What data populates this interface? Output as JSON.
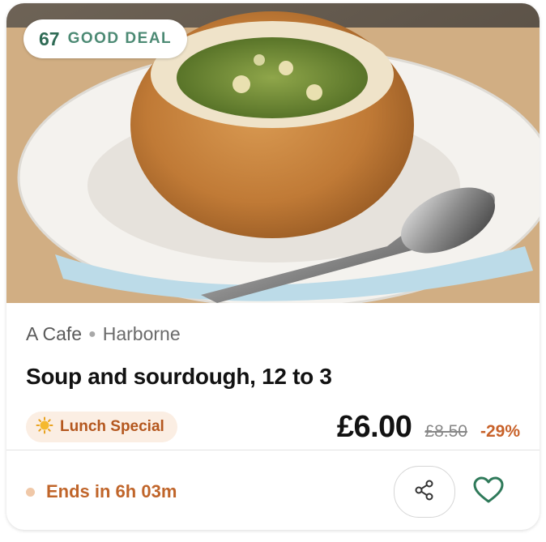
{
  "deal_badge": {
    "score": "67",
    "label": "GOOD DEAL"
  },
  "listing": {
    "venue": "A Cafe",
    "area": "Harborne",
    "title": "Soup and sourdough, 12 to 3",
    "tag_label": "Lunch Special",
    "tag_icon": "sun-icon"
  },
  "pricing": {
    "price": "£6.00",
    "original_price": "£8.50",
    "discount": "-29%"
  },
  "expiry": {
    "label": "Ends in 6h 03m"
  },
  "actions": {
    "share_icon": "share-icon",
    "favourite_icon": "heart-icon"
  },
  "colors": {
    "badge_text": "#2f6b55",
    "accent_orange": "#c0652a",
    "tag_bg": "#fbeee3",
    "heart": "#2f7a5a"
  }
}
